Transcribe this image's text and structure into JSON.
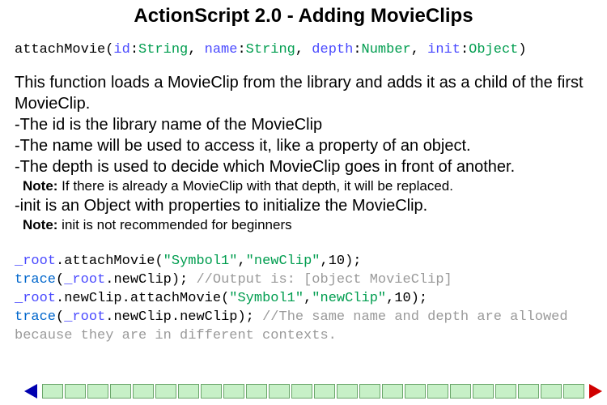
{
  "title": "ActionScript 2.0 - Adding MovieClips",
  "signature": {
    "fn": "attachMovie",
    "params": [
      {
        "name": "id",
        "type": "String"
      },
      {
        "name": "name",
        "type": "String"
      },
      {
        "name": "depth",
        "type": "Number"
      },
      {
        "name": "init",
        "type": "Object"
      }
    ]
  },
  "body": {
    "intro": "This function loads a MovieClip from the library and adds it as a child of the first MovieClip.",
    "bullet_id": "-The id is the library name of the MovieClip",
    "bullet_name": "-The name will be used to access it, like a property of an object.",
    "bullet_depth": "-The depth is used to decide which MovieClip goes in front of another.",
    "note_depth_label": "Note:",
    "note_depth": " If there is already a MovieClip with that depth, it will be replaced.",
    "bullet_init": "-init is an Object with properties to initialize the MovieClip.",
    "note_init_label": "Note:",
    "note_init": " init is not recommended for beginners"
  },
  "code": {
    "l1": {
      "root": "_root",
      "fn": "attachMovie",
      "arg1": "\"Symbol1\"",
      "arg2": "\"newClip\"",
      "arg3": "10"
    },
    "l2": {
      "kw": "trace",
      "root": "_root",
      "prop": "newClip",
      "cmt": "//Output is: [object MovieClip]"
    },
    "l3": {
      "root": "_root",
      "prop": "newClip",
      "fn": "attachMovie",
      "arg1": "\"Symbol1\"",
      "arg2": "\"newClip\"",
      "arg3": "10"
    },
    "l4": {
      "kw": "trace",
      "root": "_root",
      "prop1": "newClip",
      "prop2": "newClip",
      "cmt": "//The same name and depth are allowed because they are in different contexts."
    }
  },
  "nav": {
    "slot_count": 24
  }
}
